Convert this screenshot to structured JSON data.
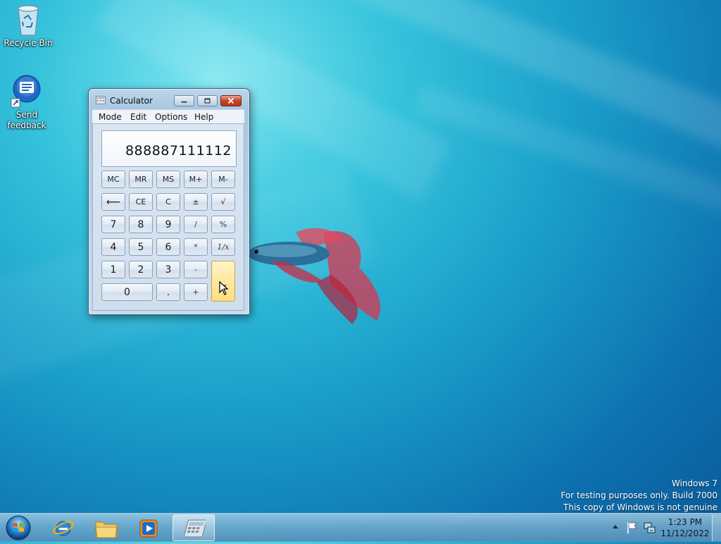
{
  "desktop": {
    "icons": [
      {
        "label": "Recycle Bin"
      },
      {
        "label": "Send feedback"
      }
    ]
  },
  "calculator": {
    "title": "Calculator",
    "menu": [
      "Mode",
      "Edit",
      "Options",
      "Help"
    ],
    "display": "888887111112",
    "keys": {
      "mc": "MC",
      "mr": "MR",
      "ms": "MS",
      "mplus": "M+",
      "mminus": "M-",
      "back": "⟵",
      "ce": "CE",
      "c": "C",
      "plusminus": "±",
      "sqrt": "√",
      "k7": "7",
      "k8": "8",
      "k9": "9",
      "div": "/",
      "pct": "%",
      "k4": "4",
      "k5": "5",
      "k6": "6",
      "mul": "*",
      "recip": "1/x",
      "k1": "1",
      "k2": "2",
      "k3": "3",
      "sub": "-",
      "eq": "=",
      "k0": "0",
      "dot": ".",
      "add": "+"
    }
  },
  "watermark": {
    "line1": "Windows 7",
    "line2": "For testing purposes only. Build 7000",
    "line3": "This copy of Windows is not genuine"
  },
  "taskbar": {
    "clock_time": "1:23 PM",
    "clock_date": "11/12/2022"
  },
  "colors": {
    "accent": "#1a9fca",
    "equals_highlight": "#ffe8a0",
    "close_button": "#c7442a"
  }
}
